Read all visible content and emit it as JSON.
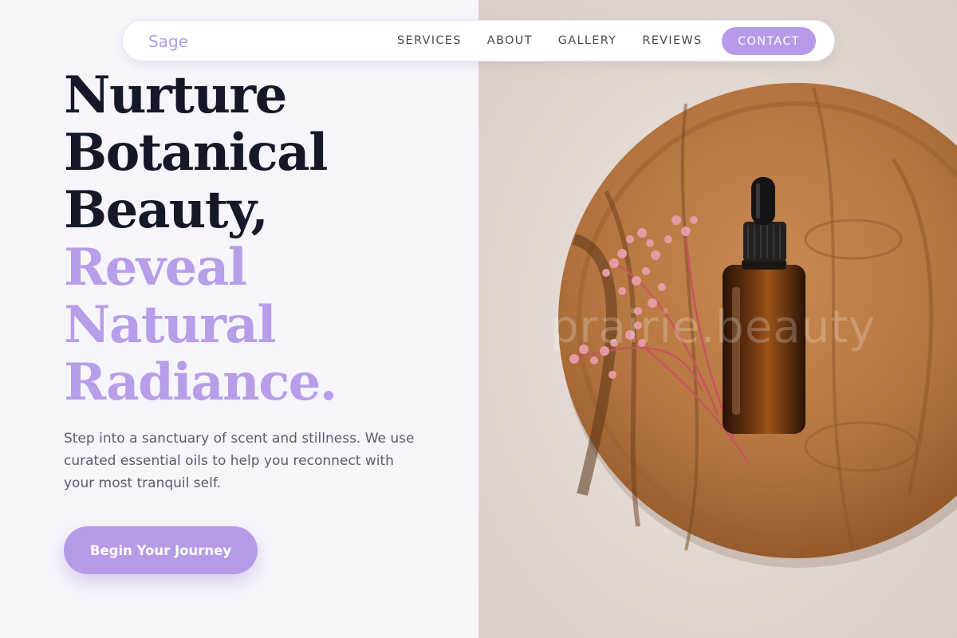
{
  "nav": {
    "brand": "Sage",
    "links": [
      "SERVICES",
      "ABOUT",
      "GALLERY",
      "REVIEWS"
    ],
    "contact_label": "CONTACT"
  },
  "hero": {
    "headline_dark": [
      "Nurture",
      "Botanical",
      "Beauty,"
    ],
    "headline_accent": [
      "Reveal",
      "Natural",
      "Radiance."
    ],
    "subtext": "Step into a sanctuary of scent and stillness. We use curated essential oils to help you reconnect with your most tranquil self.",
    "cta_label": "Begin Your Journey"
  },
  "image": {
    "watermark": "prairie.beauty"
  },
  "colors": {
    "accent": "#b69ae9",
    "heading_dark": "#141827",
    "background": "#f6f5fb",
    "body_text": "#5a5c68"
  }
}
